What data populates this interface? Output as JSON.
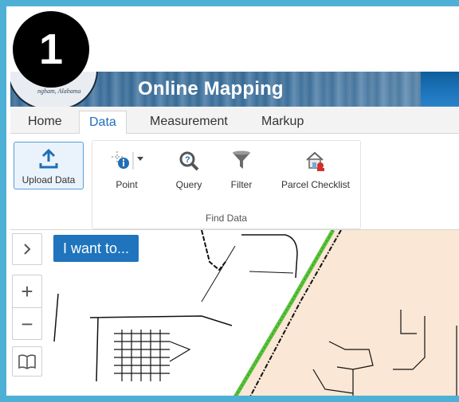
{
  "step_badge": "1",
  "banner": {
    "title": "Online Mapping",
    "seal_text": "ngham, Alabama"
  },
  "tabs": [
    {
      "label": "Home"
    },
    {
      "label": "Data",
      "active": true
    },
    {
      "label": "Measurement"
    },
    {
      "label": "Markup"
    }
  ],
  "ribbon": {
    "upload_label": "Upload Data",
    "group_label": "Find Data",
    "tools": [
      {
        "label": "Point",
        "icon": "identify-point-icon"
      },
      {
        "label": "Query",
        "icon": "query-magnifier-icon"
      },
      {
        "label": "Filter",
        "icon": "funnel-filter-icon"
      },
      {
        "label": "Parcel Checklist",
        "icon": "parcel-checklist-icon"
      }
    ]
  },
  "map": {
    "i_want_to": "I want to...",
    "expand_icon": "chevron-right-icon",
    "zoom_in": "+",
    "zoom_out": "−",
    "bookmark_icon": "book-icon",
    "colors": {
      "zone_fill": "#fbe7d6",
      "rail_green": "#58c23a",
      "road": "#111111",
      "accent": "#1f74bd"
    }
  }
}
